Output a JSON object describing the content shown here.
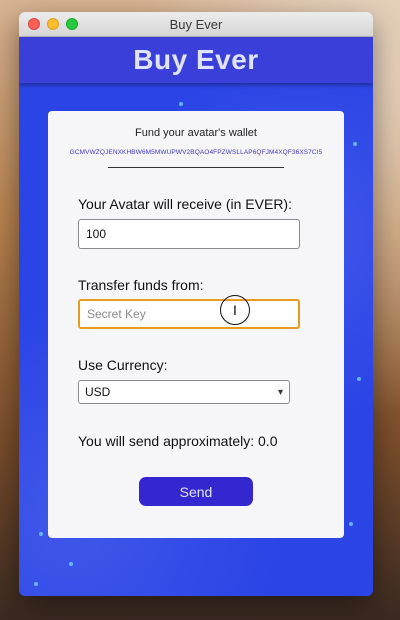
{
  "window": {
    "title": "Buy Ever"
  },
  "app": {
    "title": "Buy Ever"
  },
  "card": {
    "fund_title": "Fund your avatar's wallet",
    "wallet_address": "GCMVWZQJENXKHBW6M5MWUPWV2BQAO4FPZWSLLAP6QFJM4XQF36XS7CI5",
    "receive_label": "Your Avatar will receive (in EVER):",
    "receive_value": "100",
    "transfer_label": "Transfer funds from:",
    "secret_placeholder": "Secret Key",
    "currency_label": "Use Currency:",
    "currency_selected": "USD",
    "approx_text": "You will send approximately: 0.0",
    "send_label": "Send"
  },
  "icons": {
    "cursor": "text-cursor-icon",
    "select_arrow": "chevron-down-icon"
  },
  "colors": {
    "accent": "#3527d0",
    "background": "#2a44e6",
    "focus": "#e79b1f"
  }
}
